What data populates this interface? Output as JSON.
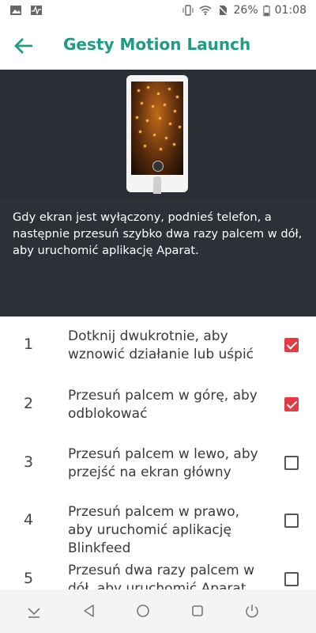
{
  "status_bar": {
    "icons_left": [
      "image-icon",
      "activity-icon"
    ],
    "icons_right": [
      "vibrate-icon",
      "wifi-icon",
      "no-sim-icon"
    ],
    "battery": "26%",
    "time": "01:08"
  },
  "app_bar": {
    "back_icon": "arrow-left-icon",
    "title": "Gesty Motion Launch"
  },
  "hero": {
    "description": "Gdy ekran jest wyłączony, podnieś telefon, a następnie przesuń szybko dwa razy palcem w dół, aby uruchomić aplikację Aparat.",
    "steps": [
      "1",
      "2",
      "3",
      "4",
      "5"
    ],
    "active_step": 5
  },
  "gestures": [
    {
      "num": "1",
      "label": "Dotknij dwukrotnie, aby wznowić działanie lub uśpić",
      "checked": true
    },
    {
      "num": "2",
      "label": "Przesuń palcem w górę, aby odblokować",
      "checked": true
    },
    {
      "num": "3",
      "label": "Przesuń palcem w lewo, aby przejść na ekran główny",
      "checked": false
    },
    {
      "num": "4",
      "label": "Przesuń palcem w prawo, aby uruchomić aplikację Blinkfeed",
      "checked": false
    },
    {
      "num": "5",
      "label": "Przesuń dwa razy palcem w dół, aby uruchomić Aparat",
      "checked": false
    }
  ],
  "nav_bar": [
    "hide-keyboard-icon",
    "back-triangle-icon",
    "home-circle-icon",
    "recents-square-icon",
    "power-icon"
  ],
  "colors": {
    "accent": "#1f9b86",
    "active": "#e33a44",
    "hero_bg": "#2d3037"
  }
}
